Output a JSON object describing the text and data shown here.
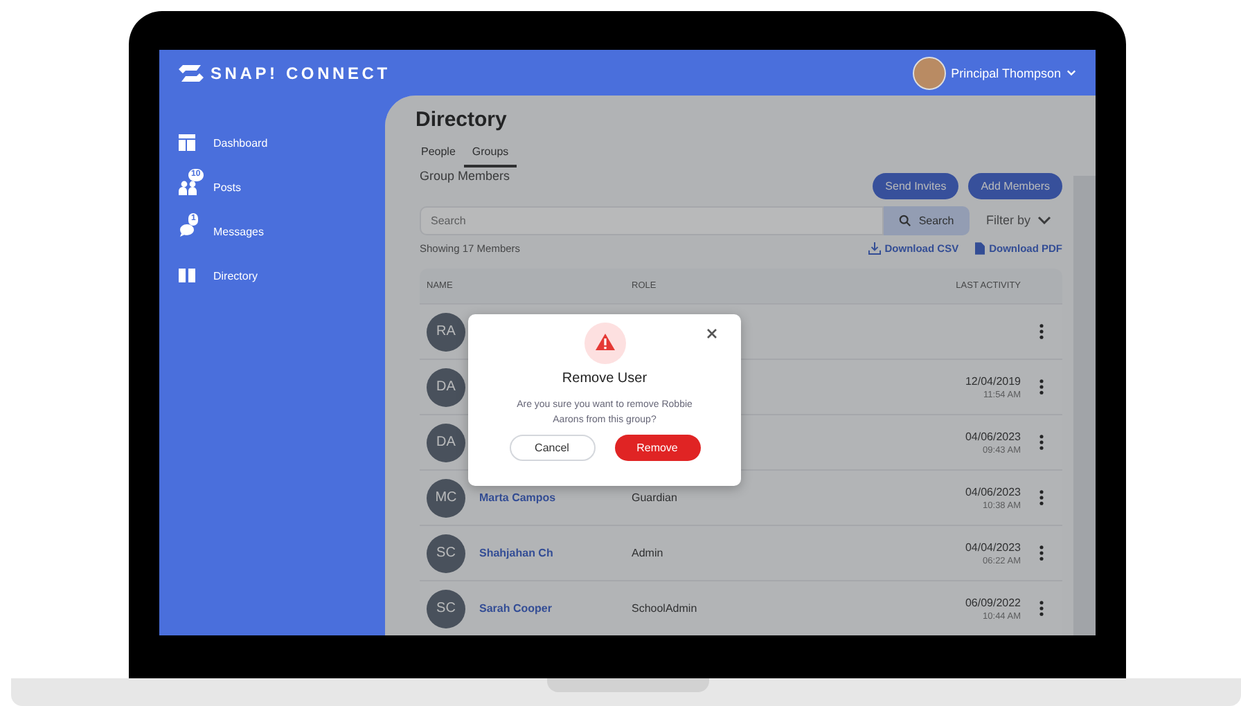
{
  "header": {
    "logo": "SNAP! CONNECT",
    "user": {
      "name": "Principal Thompson"
    }
  },
  "sidebar": {
    "items": [
      {
        "kind": "dashboard",
        "label": "Dashboard"
      },
      {
        "kind": "posts",
        "label": "Posts",
        "badge": "10"
      },
      {
        "kind": "messages",
        "label": "Messages",
        "badge": "1"
      },
      {
        "kind": "directory",
        "label": "Directory"
      }
    ]
  },
  "main": {
    "title": "Directory",
    "tabs": [
      {
        "label": "People",
        "selected": false
      },
      {
        "label": "Groups",
        "selected": true
      }
    ],
    "section_title": "Group Members",
    "buttons": [
      "Send Invites",
      "Add Members"
    ],
    "search": {
      "placeholder": "Search",
      "button": "Search"
    },
    "filter": "Filter by",
    "count": "Showing 17 Members",
    "downloads": [
      {
        "kind": "csv",
        "label": "Download CSV"
      },
      {
        "kind": "pdf",
        "label": "Download PDF"
      }
    ],
    "table": {
      "columns": [
        "NAME",
        "ROLE",
        "LAST ACTIVITY"
      ],
      "rows": [
        {
          "initials": "RA"
        },
        {
          "initials": "DA",
          "date": "12/04/2019",
          "time": "11:54 AM"
        },
        {
          "initials": "DA",
          "date": "04/06/2023",
          "time": "09:43 AM"
        },
        {
          "initials": "MC",
          "name": "Marta Campos",
          "role": "Guardian",
          "date": "04/06/2023",
          "time": "10:38 AM"
        },
        {
          "initials": "SC",
          "name": "Shahjahan Ch",
          "role": "Admin",
          "date": "04/04/2023",
          "time": "06:22 AM"
        },
        {
          "initials": "SC",
          "name": "Sarah Cooper",
          "role": "SchoolAdmin",
          "date": "06/09/2022",
          "time": "10:44 AM"
        }
      ]
    }
  },
  "dialog": {
    "title": "Remove User",
    "message": "Are you sure you want to remove Robbie Aarons from this group?",
    "buttons": [
      "Cancel",
      "Remove"
    ]
  }
}
